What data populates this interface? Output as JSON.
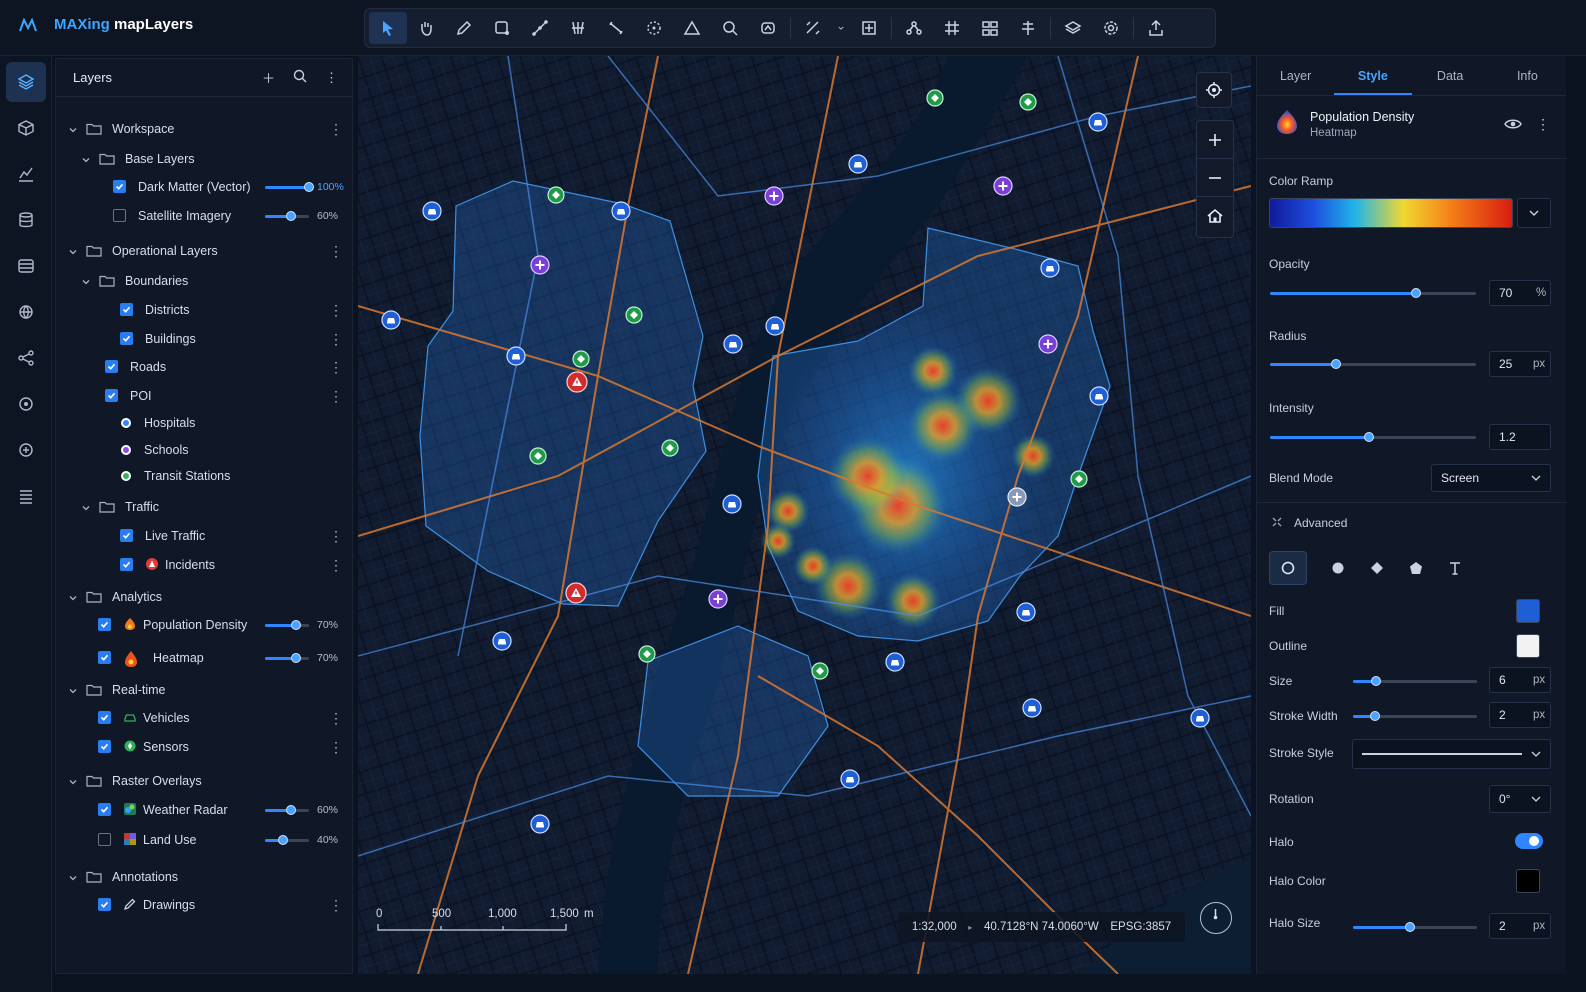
{
  "app": {
    "brand": "MAXing",
    "name": "mapLayers"
  },
  "layers_panel": {
    "title": "Layers",
    "rows": [
      {
        "label": "Workspace"
      },
      {
        "label": "Base Layers"
      },
      {
        "label": "Dark Matter (Vector)",
        "checked": true,
        "opacity": "100%"
      },
      {
        "label": "Satellite Imagery",
        "checked": false,
        "opacity": "60%"
      },
      {
        "label": "Operational Layers"
      },
      {
        "label": "Boundaries"
      },
      {
        "label": "Districts",
        "checked": true
      },
      {
        "label": "Buildings",
        "checked": true
      },
      {
        "label": "Roads",
        "checked": true
      },
      {
        "label": "POI",
        "checked": true
      },
      {
        "label": "Hospitals"
      },
      {
        "label": "Schools"
      },
      {
        "label": "Transit Stations"
      },
      {
        "label": "Traffic"
      },
      {
        "label": "Live Traffic",
        "checked": true
      },
      {
        "label": "Incidents",
        "checked": true
      },
      {
        "label": "Analytics"
      },
      {
        "label": "Population Density",
        "checked": true,
        "opacity": "70%"
      },
      {
        "label": "Heatmap",
        "checked": true,
        "opacity": "70%"
      },
      {
        "label": "Real-time"
      },
      {
        "label": "Vehicles",
        "checked": true
      },
      {
        "label": "Sensors",
        "checked": true
      },
      {
        "label": "Raster Overlays"
      },
      {
        "label": "Weather Radar",
        "checked": true,
        "opacity": "60%"
      },
      {
        "label": "Land Use",
        "checked": false,
        "opacity": "40%"
      },
      {
        "label": "Annotations"
      },
      {
        "label": "Drawings",
        "checked": true
      }
    ]
  },
  "map": {
    "scale_ticks": [
      "0",
      "500",
      "1,000",
      "1,500"
    ],
    "scale_unit": "m",
    "scale": "1:32,000",
    "coordinates": "40.7128°N 74.0060°W",
    "crs": "EPSG:3857"
  },
  "style_panel": {
    "tabs": [
      "Layer",
      "Style",
      "Data",
      "Info"
    ],
    "active_tab": "Style",
    "layer_name": "Population Density",
    "layer_type": "Heatmap",
    "color_ramp_label": "Color Ramp",
    "opacity": {
      "label": "Opacity",
      "value": "70",
      "unit": "%"
    },
    "radius": {
      "label": "Radius",
      "value": "25",
      "unit": "px"
    },
    "intensity": {
      "label": "Intensity",
      "value": "1.2"
    },
    "blend_mode": {
      "label": "Blend Mode",
      "value": "Screen"
    },
    "advanced_label": "Advanced",
    "fill": {
      "label": "Fill",
      "color": "#1f5fd6"
    },
    "outline": {
      "label": "Outline",
      "color": "#f2f2f2"
    },
    "size": {
      "label": "Size",
      "value": "6",
      "unit": "px"
    },
    "stroke_width": {
      "label": "Stroke Width",
      "value": "2",
      "unit": "px"
    },
    "stroke_style": {
      "label": "Stroke Style"
    },
    "rotation": {
      "label": "Rotation",
      "value": "0°"
    },
    "halo": {
      "label": "Halo",
      "on": true
    },
    "halo_color": {
      "label": "Halo Color",
      "color": "#000000"
    },
    "halo_size": {
      "label": "Halo Size",
      "value": "2",
      "unit": "px"
    }
  },
  "colors": {
    "accent": "#2f86ff",
    "hospital": "#2f86ff",
    "school": "#8a4ee0",
    "transit": "#2eb35a",
    "incident": "#e23a3a"
  }
}
